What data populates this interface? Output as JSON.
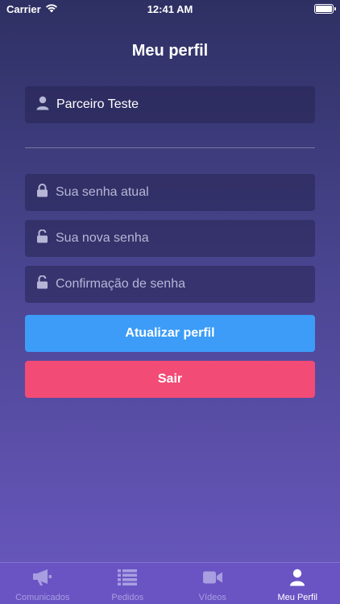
{
  "status_bar": {
    "carrier": "Carrier",
    "time": "12:41 AM"
  },
  "header": {
    "title": "Meu perfil"
  },
  "form": {
    "name_value": "Parceiro Teste",
    "current_password_placeholder": "Sua senha atual",
    "new_password_placeholder": "Sua nova senha",
    "confirm_password_placeholder": "Confirmação de senha",
    "update_label": "Atualizar perfil",
    "logout_label": "Sair"
  },
  "tab_bar": {
    "items": [
      {
        "label": "Comunicados",
        "icon": "megaphone-icon"
      },
      {
        "label": "Pedidos",
        "icon": "list-icon"
      },
      {
        "label": "Vídeos",
        "icon": "video-camera-icon"
      },
      {
        "label": "Meu Perfil",
        "icon": "user-icon"
      }
    ],
    "active_index": 3
  },
  "colors": {
    "primary_button": "#3c9cf7",
    "danger_button": "#f24b76",
    "tab_bar": "#6a54c4"
  }
}
